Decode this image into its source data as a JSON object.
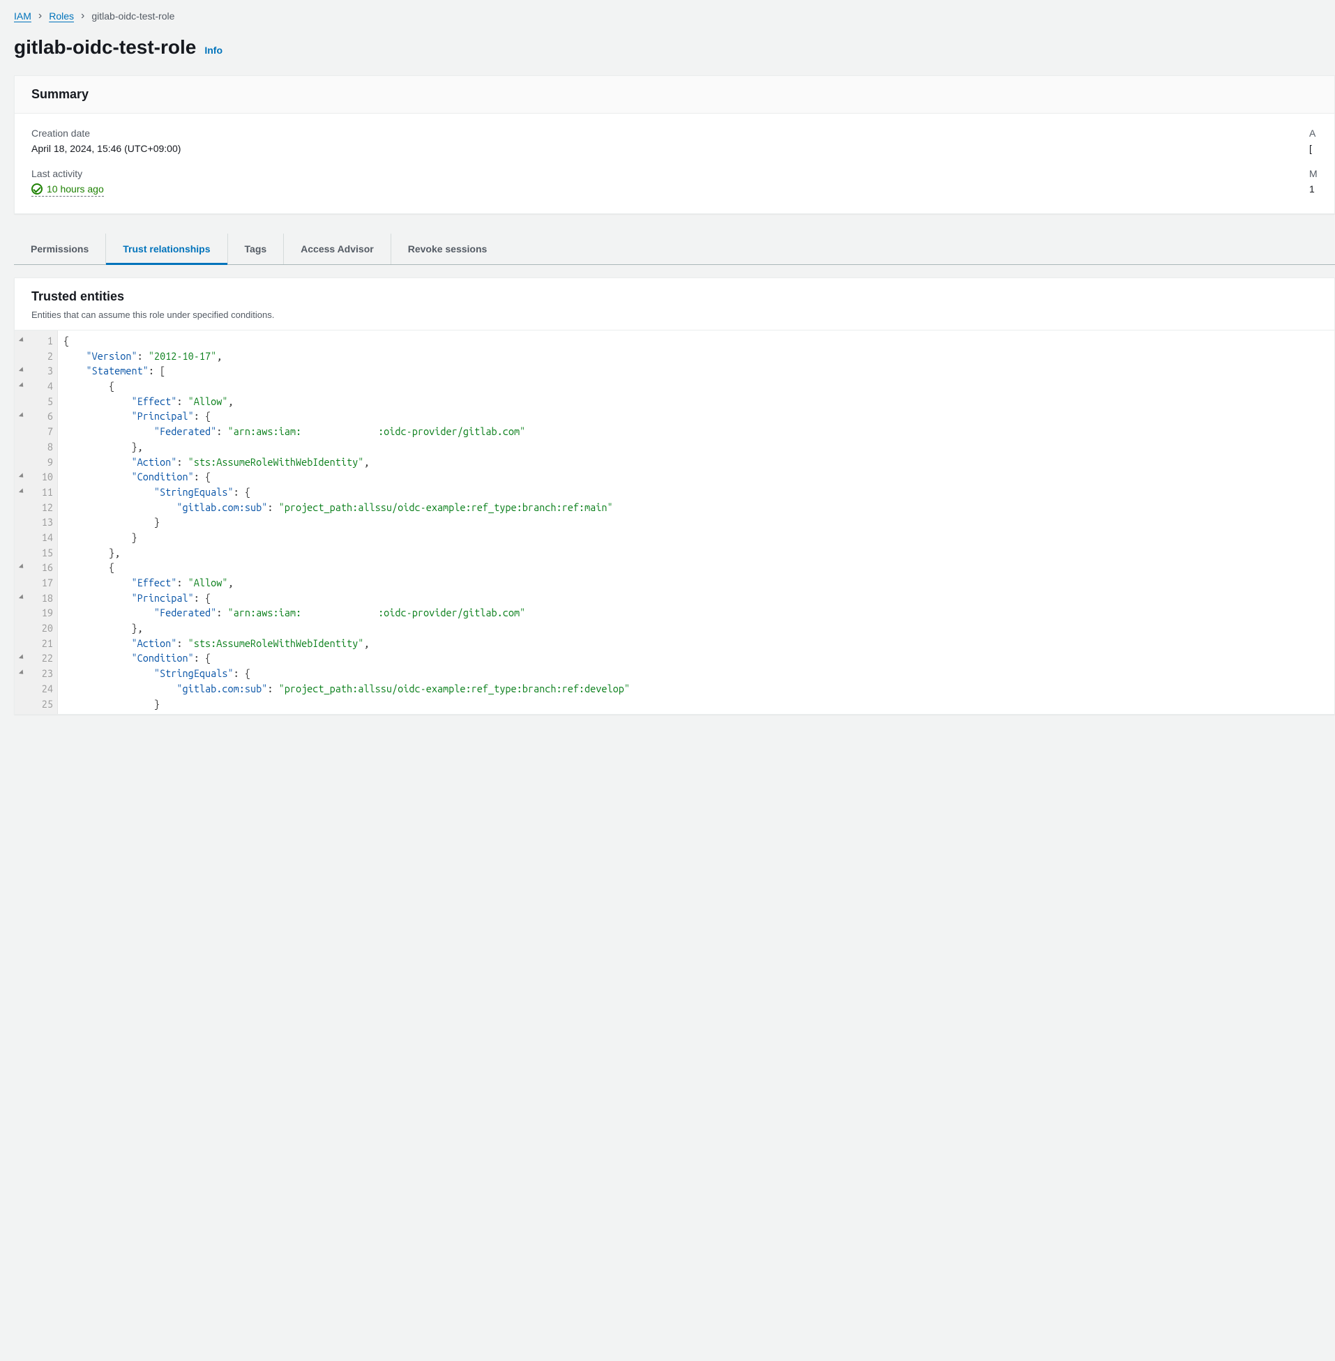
{
  "breadcrumb": {
    "root": "IAM",
    "section": "Roles",
    "current": "gitlab-oidc-test-role"
  },
  "heading": {
    "title": "gitlab-oidc-test-role",
    "info": "Info"
  },
  "summary": {
    "title": "Summary",
    "creation_date_label": "Creation date",
    "creation_date_value": "April 18, 2024, 15:46 (UTC+09:00)",
    "last_activity_label": "Last activity",
    "last_activity_value": "10 hours ago",
    "arn_label_initial": "A",
    "arn_value_initial": "[",
    "max_session_label_initial": "M",
    "max_session_value_initial": "1"
  },
  "tabs": {
    "permissions": "Permissions",
    "trust": "Trust relationships",
    "tags": "Tags",
    "access_advisor": "Access Advisor",
    "revoke": "Revoke sessions"
  },
  "trusted": {
    "title": "Trusted entities",
    "subtitle": "Entities that can assume this role under specified conditions."
  },
  "policy_document": {
    "Version": "2012-10-17",
    "Statement": [
      {
        "Effect": "Allow",
        "Principal": {
          "Federated": "arn:aws:iam:            :oidc-provider/gitlab.com"
        },
        "Action": "sts:AssumeRoleWithWebIdentity",
        "Condition": {
          "StringEquals": {
            "gitlab.com:sub": "project_path:allssu/oidc-example:ref_type:branch:ref:main"
          }
        }
      },
      {
        "Effect": "Allow",
        "Principal": {
          "Federated": "arn:aws:iam:            :oidc-provider/gitlab.com"
        },
        "Action": "sts:AssumeRoleWithWebIdentity",
        "Condition": {
          "StringEquals": {
            "gitlab.com:sub": "project_path:allssu/oidc-example:ref_type:branch:ref:develop"
          }
        }
      }
    ]
  },
  "code_lines": [
    {
      "n": 1,
      "fold": true,
      "html": "<span class='p'>{</span>"
    },
    {
      "n": 2,
      "fold": false,
      "html": "    <span class='k'>\"Version\"</span><span class='p'>: </span><span class='s'>\"2012-10-17\"</span><span class='p'>,</span>"
    },
    {
      "n": 3,
      "fold": true,
      "html": "    <span class='k'>\"Statement\"</span><span class='p'>: [</span>"
    },
    {
      "n": 4,
      "fold": true,
      "html": "        <span class='p'>{</span>"
    },
    {
      "n": 5,
      "fold": false,
      "html": "            <span class='k'>\"Effect\"</span><span class='p'>: </span><span class='s'>\"Allow\"</span><span class='p'>,</span>"
    },
    {
      "n": 6,
      "fold": true,
      "html": "            <span class='k'>\"Principal\"</span><span class='p'>: {</span>"
    },
    {
      "n": 7,
      "fold": false,
      "html": "                <span class='k'>\"Federated\"</span><span class='p'>: </span><span class='s'>\"arn:aws:iam:</span><span class='redact'>x</span><span class='s'>:oidc-provider/gitlab.com\"</span>"
    },
    {
      "n": 8,
      "fold": false,
      "html": "            <span class='p'>},</span>"
    },
    {
      "n": 9,
      "fold": false,
      "html": "            <span class='k'>\"Action\"</span><span class='p'>: </span><span class='s'>\"sts:AssumeRoleWithWebIdentity\"</span><span class='p'>,</span>"
    },
    {
      "n": 10,
      "fold": true,
      "html": "            <span class='k'>\"Condition\"</span><span class='p'>: {</span>"
    },
    {
      "n": 11,
      "fold": true,
      "html": "                <span class='k'>\"StringEquals\"</span><span class='p'>: {</span>"
    },
    {
      "n": 12,
      "fold": false,
      "html": "                    <span class='k'>\"gitlab.com:sub\"</span><span class='p'>: </span><span class='s'>\"project_path:allssu/oidc-example:ref_type:branch:ref:main\"</span>"
    },
    {
      "n": 13,
      "fold": false,
      "html": "                <span class='p'>}</span>"
    },
    {
      "n": 14,
      "fold": false,
      "html": "            <span class='p'>}</span>"
    },
    {
      "n": 15,
      "fold": false,
      "html": "        <span class='p'>},</span>"
    },
    {
      "n": 16,
      "fold": true,
      "html": "        <span class='p'>{</span>"
    },
    {
      "n": 17,
      "fold": false,
      "html": "            <span class='k'>\"Effect\"</span><span class='p'>: </span><span class='s'>\"Allow\"</span><span class='p'>,</span>"
    },
    {
      "n": 18,
      "fold": true,
      "html": "            <span class='k'>\"Principal\"</span><span class='p'>: {</span>"
    },
    {
      "n": 19,
      "fold": false,
      "html": "                <span class='k'>\"Federated\"</span><span class='p'>: </span><span class='s'>\"arn:aws:iam:</span><span class='redact'>x</span><span class='s'>:oidc-provider/gitlab.com\"</span>"
    },
    {
      "n": 20,
      "fold": false,
      "html": "            <span class='p'>},</span>"
    },
    {
      "n": 21,
      "fold": false,
      "html": "            <span class='k'>\"Action\"</span><span class='p'>: </span><span class='s'>\"sts:AssumeRoleWithWebIdentity\"</span><span class='p'>,</span>"
    },
    {
      "n": 22,
      "fold": true,
      "html": "            <span class='k'>\"Condition\"</span><span class='p'>: {</span>"
    },
    {
      "n": 23,
      "fold": true,
      "html": "                <span class='k'>\"StringEquals\"</span><span class='p'>: {</span>"
    },
    {
      "n": 24,
      "fold": false,
      "html": "                    <span class='k'>\"gitlab.com:sub\"</span><span class='p'>: </span><span class='s'>\"project_path:allssu/oidc-example:ref_type:branch:ref:develop\"</span>"
    },
    {
      "n": 25,
      "fold": false,
      "html": "                <span class='p'>}</span>"
    }
  ]
}
